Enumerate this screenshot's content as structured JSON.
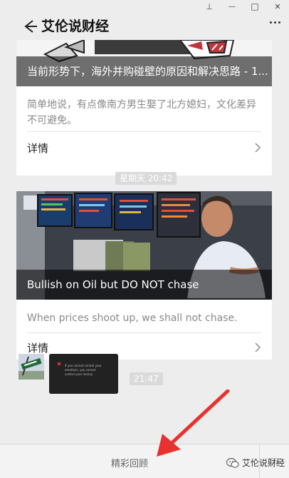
{
  "window": {
    "pin_glyph": "⊥",
    "min_glyph": "—",
    "max_glyph": "□",
    "close_glyph": "✕"
  },
  "header": {
    "title": "艾伦说财经"
  },
  "articles": [
    {
      "title": "当前形势下，海外并购碰壁的原因和解决思路 - 1...",
      "desc": "简单地说，有点像南方男生娶了北方媳妇，文化差异不可避免。",
      "detail": "详情"
    },
    {
      "title": "Bullish on Oil but DO NOT chase",
      "desc": "When prices shoot up, we shall not chase.",
      "detail": "详情"
    }
  ],
  "timestamps": [
    "星期天 20:42",
    "21:47"
  ],
  "image_msg": {
    "text": "If you cannot control your emotions, you cannot control your money."
  },
  "bottom": {
    "menu_label": "精彩回顾"
  },
  "watermark": {
    "text": "艾伦说财经"
  },
  "colors": {
    "arrow": "#e8322f",
    "overlay": "rgba(0,0,0,0.55)"
  }
}
